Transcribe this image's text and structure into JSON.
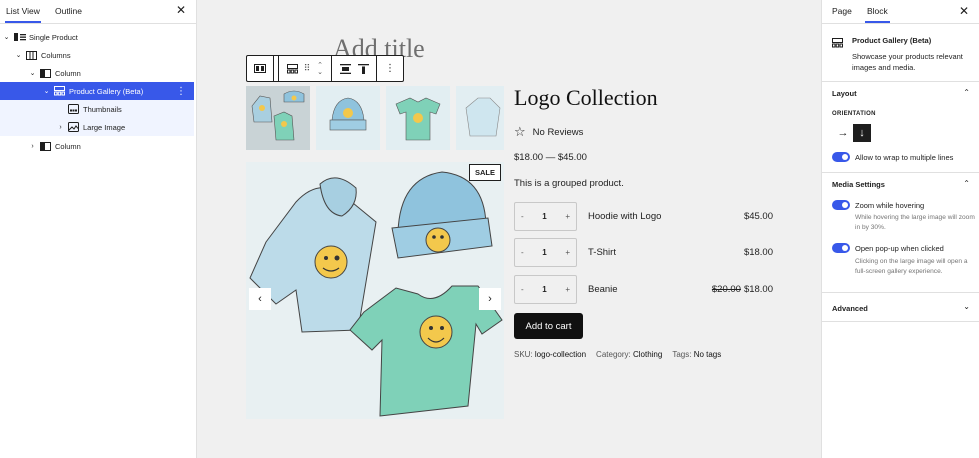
{
  "listview": {
    "tabs": [
      "List View",
      "Outline"
    ],
    "close": "✕",
    "items": [
      {
        "label": "Single Product",
        "chev": "⌄",
        "indent": 0
      },
      {
        "label": "Columns",
        "chev": "⌄",
        "indent": 1
      },
      {
        "label": "Column",
        "chev": "⌄",
        "indent": 2
      },
      {
        "label": "Product Gallery (Beta)",
        "chev": "⌄",
        "indent": 3,
        "more": "⋮"
      },
      {
        "label": "Thumbnails",
        "chev": "",
        "indent": 4
      },
      {
        "label": "Large Image",
        "chev": "›",
        "indent": 4
      },
      {
        "label": "Column",
        "chev": "›",
        "indent": 2
      }
    ]
  },
  "canvas": {
    "title_placeholder": "Add title",
    "sale_badge": "SALE",
    "prev": "‹",
    "next": "›"
  },
  "product": {
    "title": "Logo Collection",
    "reviews": "No Reviews",
    "price_range": "$18.00 — $45.00",
    "description": "This is a grouped product.",
    "rows": [
      {
        "name": "Hoodie with Logo",
        "qty": "1",
        "minus": "-",
        "plus": "+",
        "old_price": "",
        "price": "$45.00"
      },
      {
        "name": "T-Shirt",
        "qty": "1",
        "minus": "-",
        "plus": "+",
        "old_price": "",
        "price": "$18.00"
      },
      {
        "name": "Beanie",
        "qty": "1",
        "minus": "-",
        "plus": "+",
        "old_price": "$20.00",
        "price": "$18.00"
      }
    ],
    "add_to_cart": "Add to cart",
    "meta": {
      "sku_label": "SKU:",
      "sku": "logo-collection",
      "cat_label": "Category:",
      "cat": "Clothing",
      "tags_label": "Tags:",
      "tags": "No tags"
    }
  },
  "sidebar": {
    "tabs": [
      "Page",
      "Block"
    ],
    "close": "✕",
    "block_name": "Product Gallery (Beta)",
    "block_desc": "Showcase your products relevant images and media.",
    "layout": {
      "heading": "Layout",
      "orientation_label": "ORIENTATION",
      "horizontal": "→",
      "vertical": "↓",
      "wrap_label": "Allow to wrap to multiple lines"
    },
    "media": {
      "heading": "Media Settings",
      "zoom_label": "Zoom while hovering",
      "zoom_help": "While hovering the large image will zoom in by 30%.",
      "popup_label": "Open pop-up when clicked",
      "popup_help": "Clicking on the large image will open a full-screen gallery experience."
    },
    "advanced": "Advanced",
    "chev_up": "⌃",
    "chev_down": "⌄"
  },
  "colors": {
    "accent": "#3858e9",
    "canvas_bg": "#f0f0f0",
    "dark": "#1e1e1e"
  }
}
